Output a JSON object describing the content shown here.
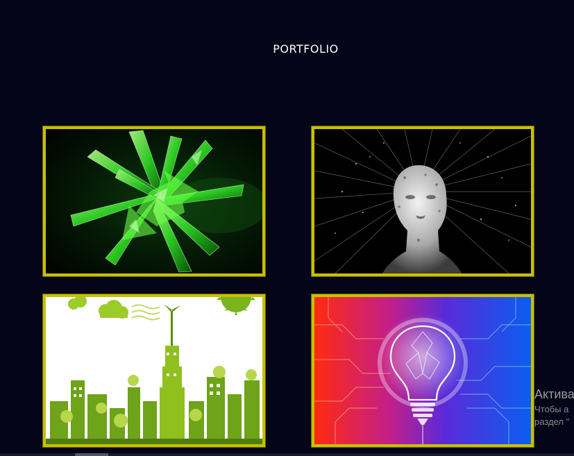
{
  "section": {
    "title": "PORTFOLIO"
  },
  "portfolio": {
    "items": [
      {
        "icon": "green-crystal-image"
      },
      {
        "icon": "digital-head-image"
      },
      {
        "icon": "eco-city-image"
      },
      {
        "icon": "circuit-lightbulb-image"
      }
    ]
  },
  "watermark": {
    "title": "Актива",
    "line1": "Чтобы а",
    "line2": "раздел \""
  },
  "colors": {
    "background": "#05051a",
    "frame": "#c7c000",
    "title": "#ffffff"
  }
}
